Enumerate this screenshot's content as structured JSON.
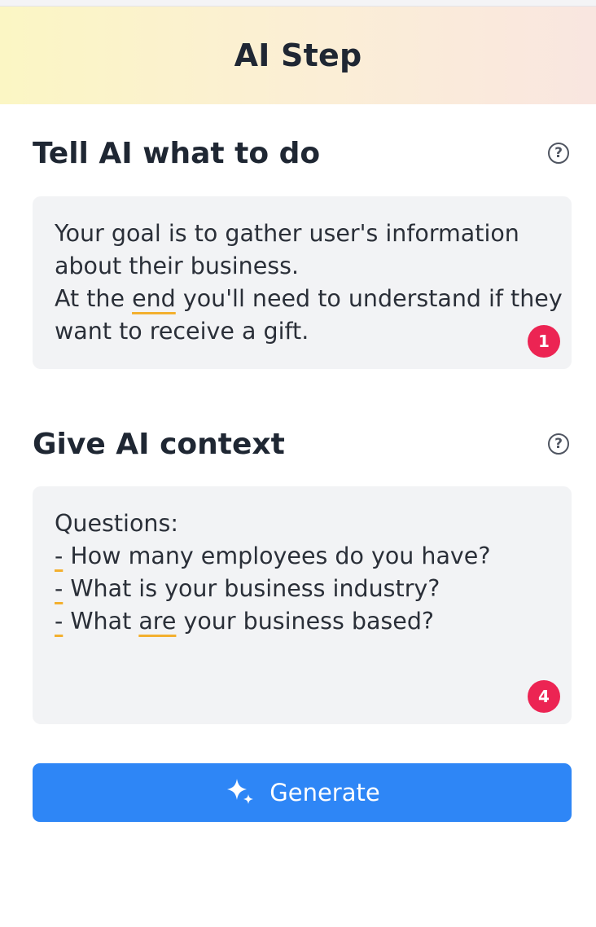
{
  "header": {
    "title": "AI Step"
  },
  "sections": [
    {
      "title": "Tell AI what to do",
      "help_icon": "question-circle-icon",
      "text_lines": [
        "Your goal is to gather user's information",
        "about their business.",
        "At the end you'll need to understand if they",
        "want to receive a gift."
      ],
      "badge": "1"
    },
    {
      "title": "Give AI context",
      "help_icon": "question-circle-icon",
      "text_lines": [
        "Questions:",
        "- How many employees do you have?",
        "- What is your business industry?",
        "- What are your business based?"
      ],
      "badge": "4"
    }
  ],
  "generate": {
    "label": "Generate",
    "icon": "sparkle-icon"
  },
  "colors": {
    "accent": "#2e86f6",
    "badge": "#ec2453",
    "underline": "#f3b02f",
    "textbox_bg": "#f2f3f5"
  }
}
